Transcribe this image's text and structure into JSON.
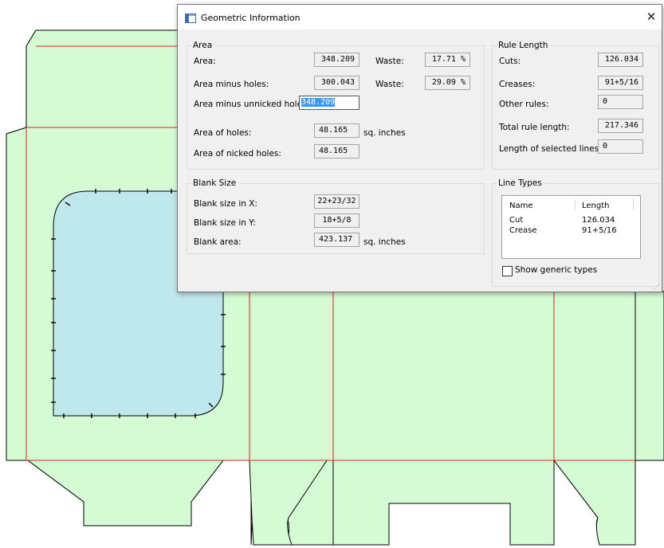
{
  "dialog": {
    "title": "Geometric Information",
    "close_glyph": "✕",
    "area": {
      "legend": "Area",
      "area_label": "Area:",
      "area_value": "348.209",
      "waste1_label": "Waste:",
      "waste1_value": "17.71 %",
      "minus_holes_label": "Area minus holes:",
      "minus_holes_value": "300.043",
      "waste2_label": "Waste:",
      "waste2_value": "29.09 %",
      "minus_unnicked_label": "Area minus unnicked holes:",
      "minus_unnicked_value": "348.209",
      "holes_label": "Area of holes:",
      "holes_value": "48.165",
      "holes_unit": "sq. inches",
      "nicked_label": "Area of nicked holes:",
      "nicked_value": "48.165"
    },
    "blank": {
      "legend": "Blank Size",
      "x_label": "Blank size in X:",
      "x_value": "22+23/32",
      "y_label": "Blank size in Y:",
      "y_value": "18+5/8",
      "area_label": "Blank area:",
      "area_value": "423.137",
      "area_unit": "sq. inches"
    },
    "rule_length": {
      "legend": "Rule Length",
      "cuts_label": "Cuts:",
      "cuts_value": "126.034",
      "creases_label": "Creases:",
      "creases_value": "91+5/16",
      "other_label": "Other rules:",
      "other_value": "0",
      "total_label": "Total rule length:",
      "total_value": "217.346",
      "selected_label": "Length of selected lines:",
      "selected_value": "0"
    },
    "line_types": {
      "legend": "Line Types",
      "col_name": "Name",
      "col_length": "Length",
      "rows": [
        {
          "name": "Cut",
          "length": "126.034"
        },
        {
          "name": "Crease",
          "length": "91+5/16"
        }
      ],
      "show_generic_label": "Show generic types",
      "show_generic_checked": false
    }
  },
  "colors": {
    "panel_fill": "#d5fbd5",
    "window_fill": "#bfe8ec",
    "crease_line": "#e02020",
    "cut_line": "#000000"
  }
}
